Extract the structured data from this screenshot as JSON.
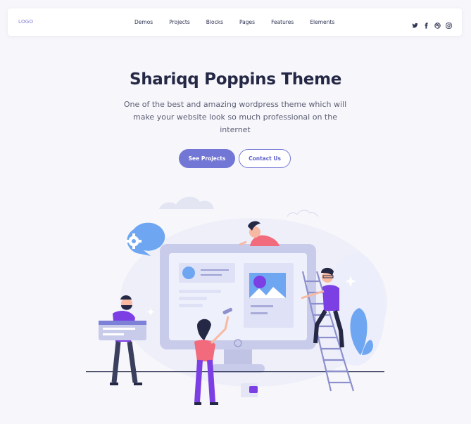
{
  "navbar": {
    "logo": "LOGO",
    "menu": [
      {
        "label": "Demos"
      },
      {
        "label": "Projects"
      },
      {
        "label": "Blocks"
      },
      {
        "label": "Pages"
      },
      {
        "label": "Features"
      },
      {
        "label": "Elements"
      }
    ],
    "social_icons": [
      "twitter-icon",
      "facebook-icon",
      "dribbble-icon",
      "instagram-icon"
    ]
  },
  "hero": {
    "title": "Shariqq Poppins Theme",
    "subtitle": "One of the best and amazing wordpress theme which will make your website look so much professional on the internet",
    "primary_button": "See Projects",
    "secondary_button": "Contact Us"
  },
  "colors": {
    "accent": "#7276d4",
    "title": "#252845",
    "background": "#f6f6fb",
    "illustration_purple": "#7b3fe4",
    "illustration_pink": "#f16b7c"
  }
}
